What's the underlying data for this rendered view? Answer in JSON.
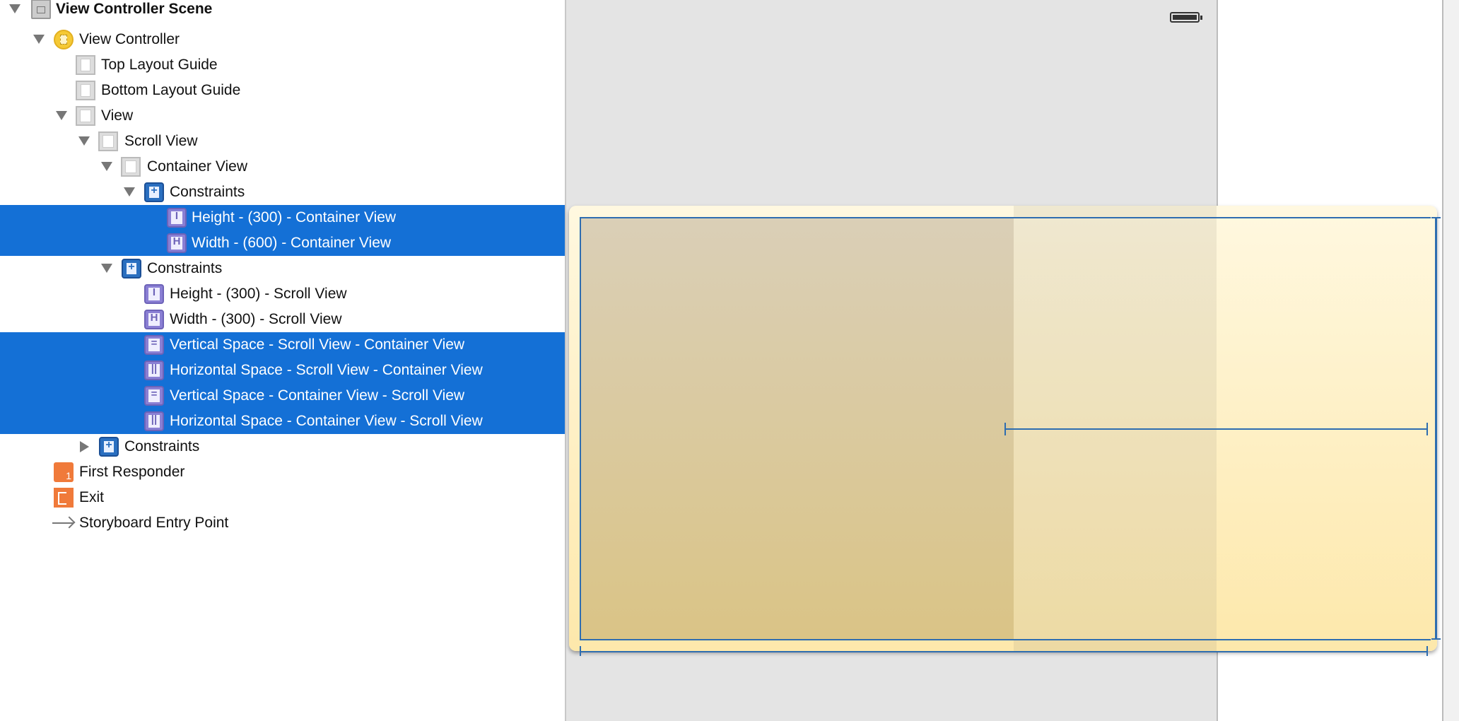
{
  "outline": {
    "scene": "View Controller Scene",
    "view_controller": "View Controller",
    "top_layout_guide": "Top Layout Guide",
    "bottom_layout_guide": "Bottom Layout Guide",
    "view": "View",
    "scroll_view": "Scroll View",
    "container_view": "Container View",
    "container_constraints": {
      "label": "Constraints",
      "items": [
        "Height - (300) - Container View",
        "Width - (600) - Container View"
      ]
    },
    "scroll_constraints": {
      "label": "Constraints",
      "items": [
        "Height - (300) - Scroll View",
        "Width - (300) - Scroll View",
        "Vertical Space - Scroll View - Container View",
        "Horizontal Space - Scroll View - Container View",
        "Vertical Space - Container View - Scroll View",
        "Horizontal Space - Container View - Scroll View"
      ]
    },
    "view_constraints": "Constraints",
    "first_responder": "First Responder",
    "exit": "Exit",
    "entry_point": "Storyboard Entry Point"
  },
  "colors": {
    "selection": "#1470d6",
    "constraint_line": "#2e6db0",
    "canvas": "#e4e4e4"
  },
  "icons": {
    "selected_state": "highlighted-rows"
  }
}
